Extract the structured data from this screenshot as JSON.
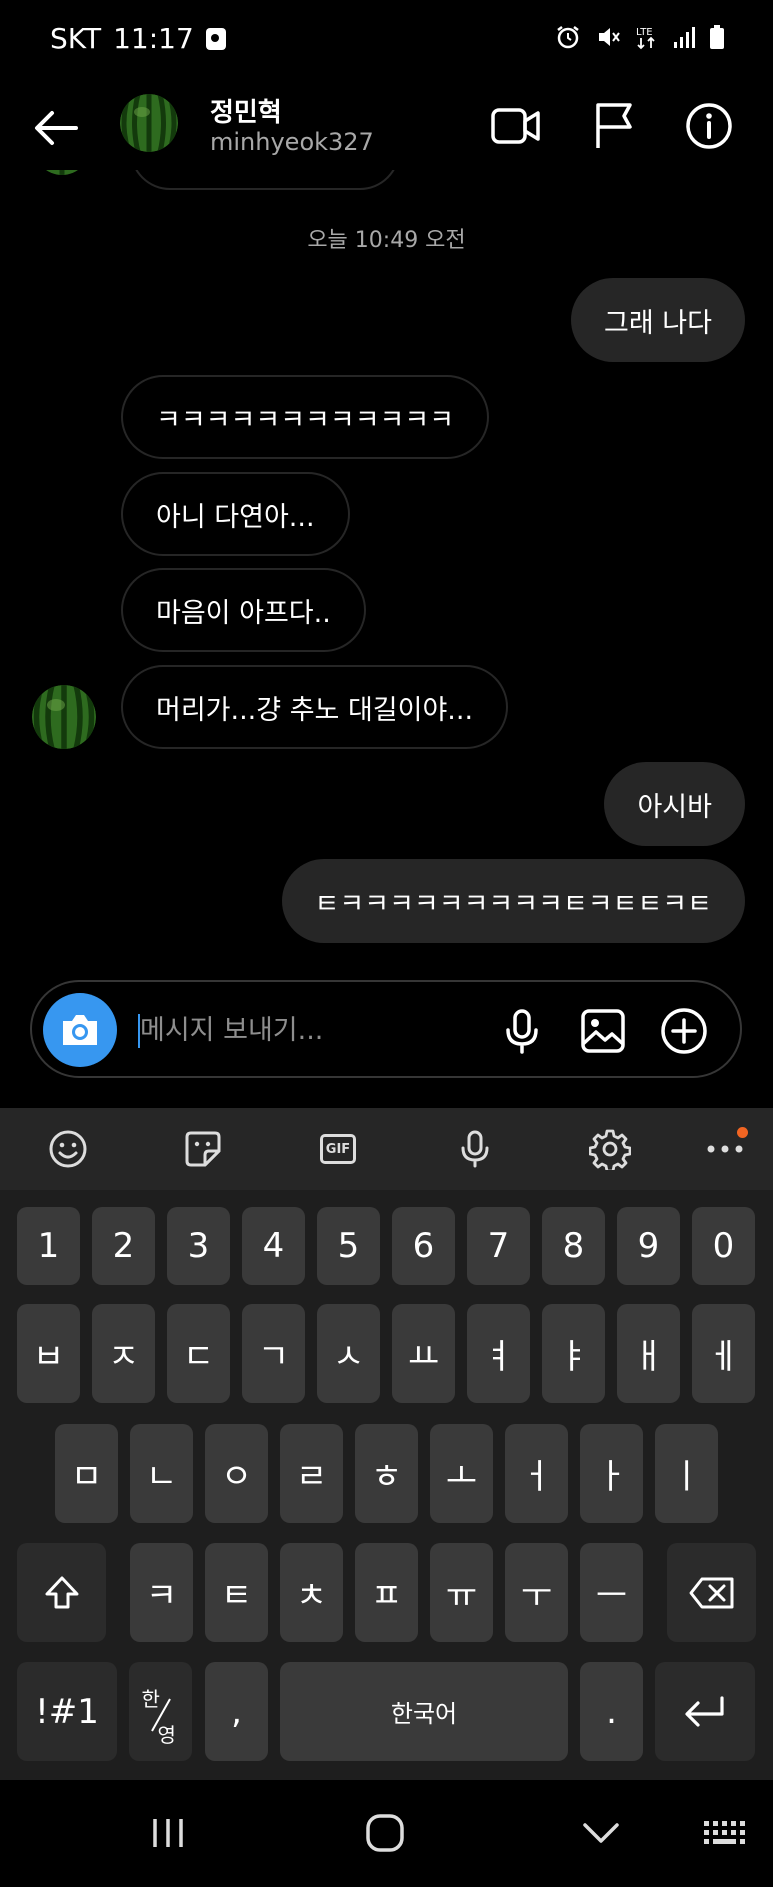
{
  "status_bar": {
    "carrier": "SKT",
    "time": "11:17",
    "network": "LTE"
  },
  "header": {
    "name": "정민혁",
    "username": "minhyeok327"
  },
  "chat": {
    "timestamp": "오늘 10:49 오전",
    "messages": [
      {
        "side": "out",
        "text": "그래 나다"
      },
      {
        "side": "in",
        "text": "ㅋㅋㅋㅋㅋㅋㅋㅋㅋㅋㅋㅋ"
      },
      {
        "side": "in",
        "text": "아니 다연아..."
      },
      {
        "side": "in",
        "text": "마음이 아프다.."
      },
      {
        "side": "in",
        "text": "머리가...걍 추노 대길이야...",
        "avatar": true
      },
      {
        "side": "out",
        "text": "아시바"
      },
      {
        "side": "out",
        "text": "ㅌㅋㅋㅋㅋㅋㅋㅋㅋㅋㅌㅋㅌㅌㅋㅌ"
      }
    ]
  },
  "composer": {
    "placeholder": "메시지 보내기..."
  },
  "keyboard": {
    "toolbar": [
      "emoji-icon",
      "sticker-icon",
      "gif-icon",
      "voice-input-icon",
      "settings-icon",
      "more-icon"
    ],
    "gif_label": "GIF",
    "row1": [
      "1",
      "2",
      "3",
      "4",
      "5",
      "6",
      "7",
      "8",
      "9",
      "0"
    ],
    "row2": [
      "ㅂ",
      "ㅈ",
      "ㄷ",
      "ㄱ",
      "ㅅ",
      "ㅛ",
      "ㅕ",
      "ㅑ",
      "ㅐ",
      "ㅔ"
    ],
    "row3": [
      "ㅁ",
      "ㄴ",
      "ㅇ",
      "ㄹ",
      "ㅎ",
      "ㅗ",
      "ㅓ",
      "ㅏ",
      "ㅣ"
    ],
    "row4": [
      "ㅋ",
      "ㅌ",
      "ㅊ",
      "ㅍ",
      "ㅠ",
      "ㅜ",
      "ㅡ"
    ],
    "symbols": "!#1",
    "lang_top": "한",
    "lang_bottom": "영",
    "comma": ",",
    "space": "한국어",
    "period": "."
  },
  "colors": {
    "background": "#000000",
    "bubble_out": "#262626",
    "bubble_in_border": "#262626",
    "accent": "#3797f0",
    "notification_dot": "#f26522"
  }
}
